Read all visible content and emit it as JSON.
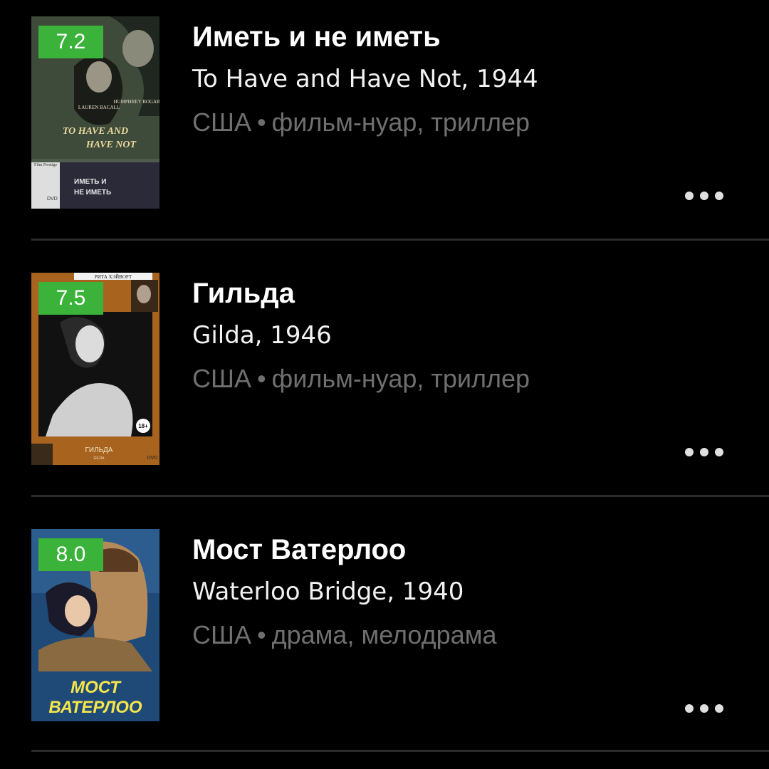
{
  "films": [
    {
      "rating": "7.2",
      "rating_color": "#3bb33b",
      "title": "Иметь и не иметь",
      "original": "To Have and Have Not, 1944",
      "country": "США",
      "separator": "•",
      "genres": "фильм-нуар, триллер",
      "poster_text": [
        "HUMPHREY BOGART",
        "LAUREN BACALL",
        "TO HAVE AND",
        "HAVE NOT",
        "Film Prestige",
        "ИМЕТЬ И",
        "НЕ ИМЕТЬ",
        "DVD"
      ]
    },
    {
      "rating": "7.5",
      "rating_color": "#3bb33b",
      "title": "Гильда",
      "original": "Gilda, 1946",
      "country": "США",
      "separator": "•",
      "genres": "фильм-нуар, триллер",
      "poster_text": [
        "РИТА ХЭЙВОРТ",
        "18+",
        "ГИЛЬДА",
        "GILDA",
        "DVD"
      ]
    },
    {
      "rating": "8.0",
      "rating_color": "#3bb33b",
      "title": "Мост Ватерлоо",
      "original": "Waterloo Bridge, 1940",
      "country": "США",
      "separator": "•",
      "genres": "драма, мелодрама",
      "poster_text": [
        "МОСТ",
        "ВАТЕРЛОО"
      ]
    }
  ],
  "icons": {
    "more": "more-dots-icon"
  },
  "colors": {
    "background": "#000000",
    "title": "#ffffff",
    "meta": "#6f6f6f",
    "divider": "#2c2c2c"
  }
}
